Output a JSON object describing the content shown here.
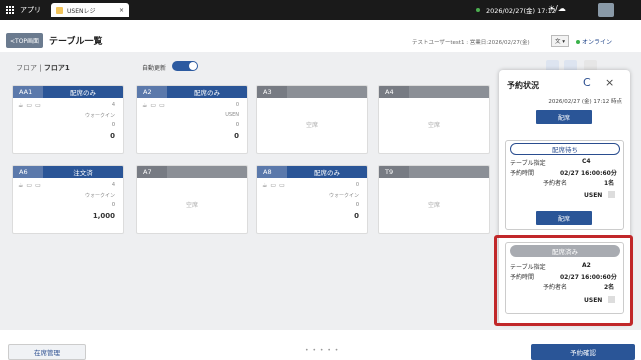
{
  "topbar": {
    "app_label": "アプリ",
    "tab_label": "USENレジ",
    "tab_close": "×",
    "datetime": "2026/02/27(金) 17:12",
    "weather": "☀/☁"
  },
  "header": {
    "top_button": "<TOP画面",
    "title": "テーブル一覧",
    "user_info": "テストユーザーtest1 : 営業日:2026/02/27(金)",
    "lang": "文 ▾",
    "online": "オンライン"
  },
  "floor": {
    "label": "フロア",
    "separator": "|",
    "name": "フロア1",
    "auto_refresh": "自動更新"
  },
  "tables": [
    {
      "num": "AA1",
      "status": "配席のみ",
      "type": "occupied",
      "count": "4",
      "walkin": "ウォークイン",
      "guests": "0",
      "val": "0"
    },
    {
      "num": "A2",
      "status": "配席のみ",
      "type": "occupied",
      "count": "0",
      "walkin": "USEN",
      "guests": "0",
      "val": "0"
    },
    {
      "num": "A3",
      "status": "",
      "type": "empty",
      "empty_text": "空席"
    },
    {
      "num": "A4",
      "status": "",
      "type": "empty",
      "empty_text": "空席"
    },
    {
      "num": "A6",
      "status": "注文済",
      "type": "occupied",
      "count": "4",
      "walkin": "ウォークイン",
      "guests": "0",
      "val": "1,000"
    },
    {
      "num": "A7",
      "status": "",
      "type": "empty",
      "empty_text": "空席"
    },
    {
      "num": "A8",
      "status": "配席のみ",
      "type": "occupied",
      "count": "0",
      "walkin": "ウォークイン",
      "guests": "0",
      "val": "0"
    },
    {
      "num": "T9",
      "status": "",
      "type": "empty",
      "empty_text": "空席"
    }
  ],
  "panel": {
    "title": "予約状況",
    "refresh": "C",
    "close": "×",
    "time": "2026/02/27 (金) 17:12 時点",
    "btn1": "配席",
    "res1": {
      "status": "配席待ち",
      "table_label": "テーブル指定",
      "table": "C4",
      "time_label": "予約時間",
      "time": "02/27 16:00:60分",
      "name_label": "予約者名",
      "count": "1名",
      "source": "USEN",
      "btn": "配席"
    },
    "res2": {
      "status": "配席済み",
      "table_label": "テーブル指定",
      "table": "A2",
      "time_label": "予約時間",
      "time": "02/27 16:00:60分",
      "name_label": "予約者名",
      "count": "2名",
      "source": "USEN"
    }
  },
  "bottom": {
    "seat_mgmt": "在席管理",
    "dots": "• • • • •",
    "reservation": "予約確認"
  },
  "colors": {
    "accent": "#2a5597",
    "highlight": "#c1282a"
  }
}
